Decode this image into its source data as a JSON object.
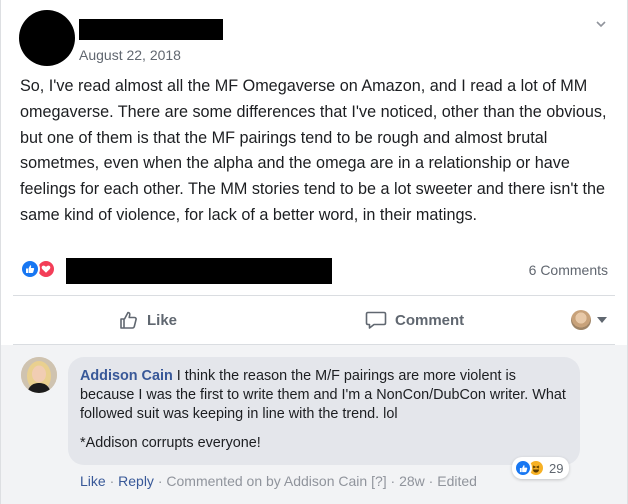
{
  "post": {
    "date": "August 22, 2018",
    "text": "So, I've read almost all the MF Omegaverse on Amazon, and I read a lot of MM omegaverse. There are some differences that I've noticed, other than the obvious, but one of them is that the MF pairings tend to be rough and almost brutal sometmes, even when the alpha and the omega are in a relationship or have feelings for each other. The MM stories tend to be a lot sweeter and there isn't the same kind of violence, for lack of a better word, in their matings.",
    "reactions": [
      "like-icon",
      "love-icon"
    ],
    "comments_count": "6 Comments"
  },
  "actions": {
    "like_label": "Like",
    "comment_label": "Comment"
  },
  "comment": {
    "author": "Addison Cain",
    "text": "I think the reason the M/F pairings are more violent is because I was the first to write them and I'm a NonCon/DubCon writer. What followed suit was keeping in line with the trend. lol",
    "text2": "*Addison corrupts everyone!",
    "reaction_count": "29",
    "like_link": "Like",
    "sep1": " · ",
    "reply_link": "Reply",
    "sep2": " · ",
    "commented_by": "Commented on by Addison Cain [?]",
    "sep3": " · ",
    "age": "28w",
    "sep4": " · ",
    "edited": "Edited"
  },
  "colors": {
    "brand_blue": "#1877f2",
    "love_red": "#f33e58",
    "link_blue": "#385898"
  }
}
